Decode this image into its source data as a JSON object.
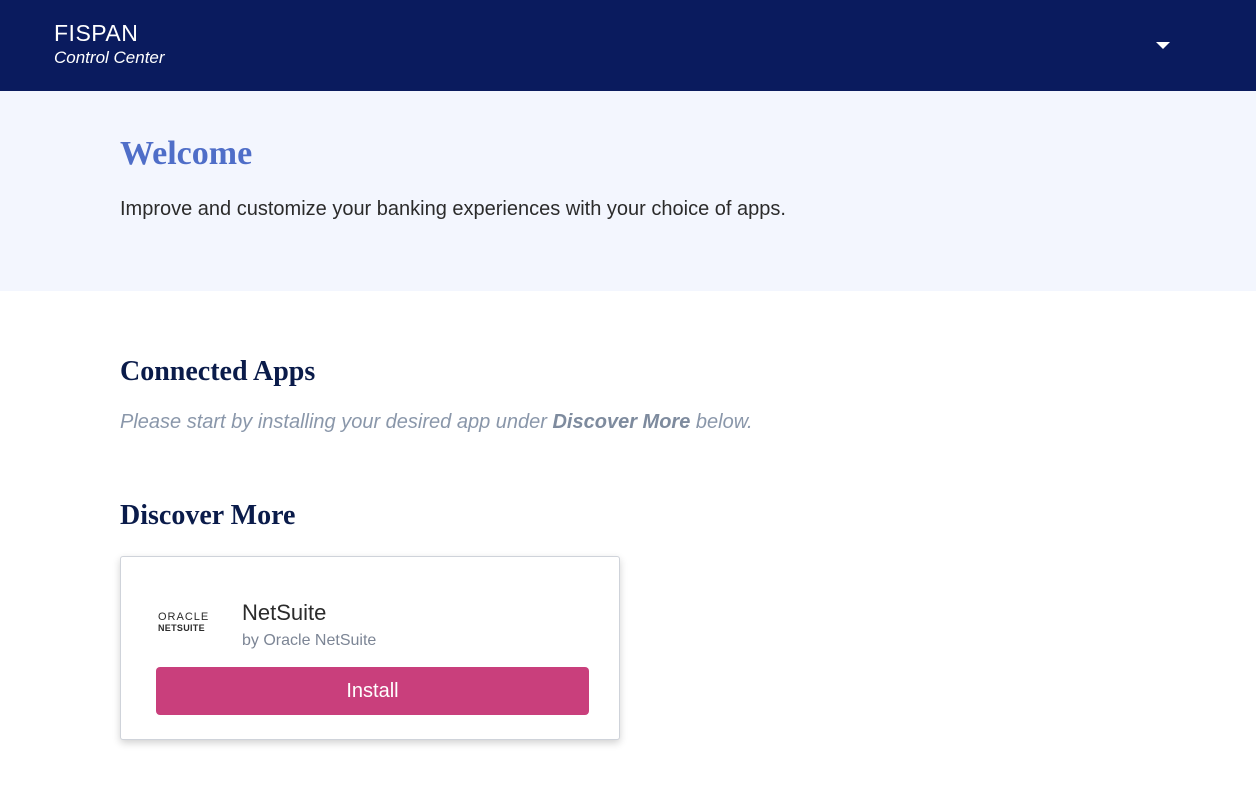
{
  "header": {
    "brand_name": "FISPAN",
    "brand_sub": "Control Center",
    "menu_icon": "caret-down-icon",
    "background_color": "#0a1b5e"
  },
  "hero": {
    "title": "Welcome",
    "text": "Improve and customize your banking experiences with your choice of apps.",
    "background_color": "#f3f6fe"
  },
  "connected_apps": {
    "title": "Connected Apps",
    "hint_prefix": "Please start by installing your desired app under ",
    "hint_emphasis": "Discover More",
    "hint_suffix": " below."
  },
  "discover_more": {
    "title": "Discover More",
    "apps": [
      {
        "logo_line1": "ORACLE",
        "logo_line2": "NETSUITE",
        "name": "NetSuite",
        "vendor": "by Oracle NetSuite",
        "action_label": "Install",
        "action_color": "#c93f7c"
      }
    ]
  }
}
